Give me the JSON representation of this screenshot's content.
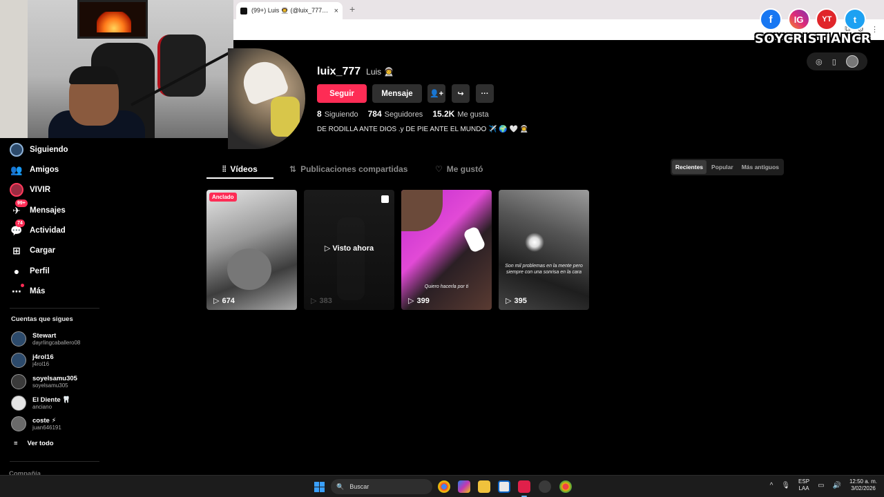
{
  "browser": {
    "tab_title": "(99+) Luis 👨‍🚀 (@luix_777) | TikTok",
    "new_tab_symbol": "+",
    "close_symbol": "×"
  },
  "overlay": {
    "brand_name": "SOYCRISTIANCR",
    "socials": [
      "f",
      "IG",
      "YT",
      "t"
    ]
  },
  "sidebar": {
    "items": [
      {
        "label": "Siguiendo",
        "icon": "following-avatar-icon"
      },
      {
        "label": "Amigos",
        "icon": "friends-icon"
      },
      {
        "label": "VIVIR",
        "icon": "live-icon"
      },
      {
        "label": "Mensajes",
        "icon": "messages-icon",
        "badge": "99+"
      },
      {
        "label": "Actividad",
        "icon": "activity-icon",
        "badge": "74"
      },
      {
        "label": "Cargar",
        "icon": "upload-icon"
      },
      {
        "label": "Perfil",
        "icon": "profile-icon"
      },
      {
        "label": "Más",
        "icon": "more-icon"
      }
    ],
    "following_title": "Cuentas que sigues",
    "accounts": [
      {
        "name": "Stewart",
        "handle": "dayrlingcaballero08"
      },
      {
        "name": "j4rol16",
        "handle": "j4rol16"
      },
      {
        "name": "soyelsamu305",
        "handle": "soyelsamu305"
      },
      {
        "name": "El Diente 🦷",
        "handle": "anciano"
      },
      {
        "name": "coste ⚡",
        "handle": "juan646191"
      }
    ],
    "see_all": "Ver todo",
    "company": "Compañía"
  },
  "profile": {
    "username": "luix_777",
    "nickname": "Luis 👨‍🚀",
    "follow_label": "Seguir",
    "message_label": "Mensaje",
    "stats": [
      {
        "value": "8",
        "label": "Siguiendo"
      },
      {
        "value": "784",
        "label": "Seguidores"
      },
      {
        "value": "15.2K",
        "label": "Me gusta"
      }
    ],
    "bio": "DE RODILLA ANTE DIOS .y DE PIE ANTE EL MUNDO ✈️ 🌍 🤍 👨‍🚀"
  },
  "tabs": {
    "videos": "Vídeos",
    "reposts": "Publicaciones compartidas",
    "liked": "Me gustó",
    "sort": [
      "Recientes",
      "Popular",
      "Más antiguos"
    ]
  },
  "videos": [
    {
      "views": "674",
      "pinned_label": "Anclado"
    },
    {
      "views": "383",
      "overlay": "Visto ahora"
    },
    {
      "views": "399",
      "caption": "Quiero hacerla por ti"
    },
    {
      "views": "395",
      "caption": "Son mil problemas en la mente pero siempre con una sonrisa en la cara"
    }
  ],
  "taskbar": {
    "search_placeholder": "Buscar",
    "lang_line1": "ESP",
    "lang_line2": "LAA",
    "time": "12:50 a. m.",
    "date": "3/02/2026"
  },
  "colors": {
    "accent": "#fe2c55",
    "background": "#000000",
    "button_dark": "#2f2f2f"
  }
}
